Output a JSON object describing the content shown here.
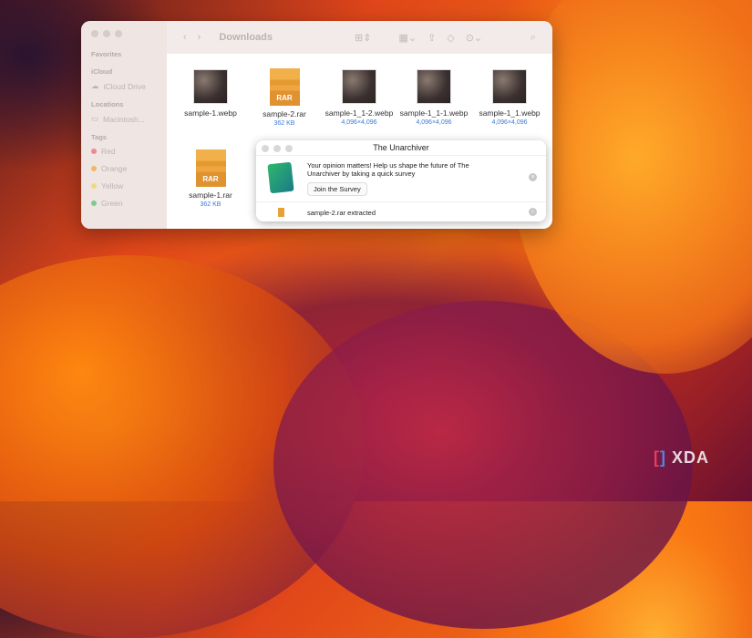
{
  "finder": {
    "title": "Downloads",
    "sidebar": {
      "favorites": "Favorites",
      "icloud": "iCloud",
      "icloud_drive": "iCloud Drive",
      "locations": "Locations",
      "macintosh": "Macintosh...",
      "tags": "Tags",
      "tag_items": [
        {
          "label": "Red",
          "color": "#f08a8a"
        },
        {
          "label": "Orange",
          "color": "#f0b868"
        },
        {
          "label": "Yellow",
          "color": "#eedc7a"
        },
        {
          "label": "Green",
          "color": "#7ccc88"
        }
      ]
    },
    "files": [
      {
        "name": "sample-1.webp",
        "info": ""
      },
      {
        "name": "sample-2.rar",
        "info": "362 KB"
      },
      {
        "name": "sample-1_1-2.webp",
        "info": "4,096×4,096"
      },
      {
        "name": "sample-1_1-1.webp",
        "info": "4,096×4,096"
      },
      {
        "name": "sample-1_1.webp",
        "info": "4,096×4,096"
      },
      {
        "name": "sample-1.rar",
        "info": "362 KB"
      }
    ],
    "rar_label": "RAR"
  },
  "dialog": {
    "title": "The Unarchiver",
    "message": "Your opinion matters! Help us shape the future of The Unarchiver by taking a quick survey",
    "button": "Join the Survey",
    "status": "sample-2.rar extracted"
  },
  "watermark": "XDA"
}
